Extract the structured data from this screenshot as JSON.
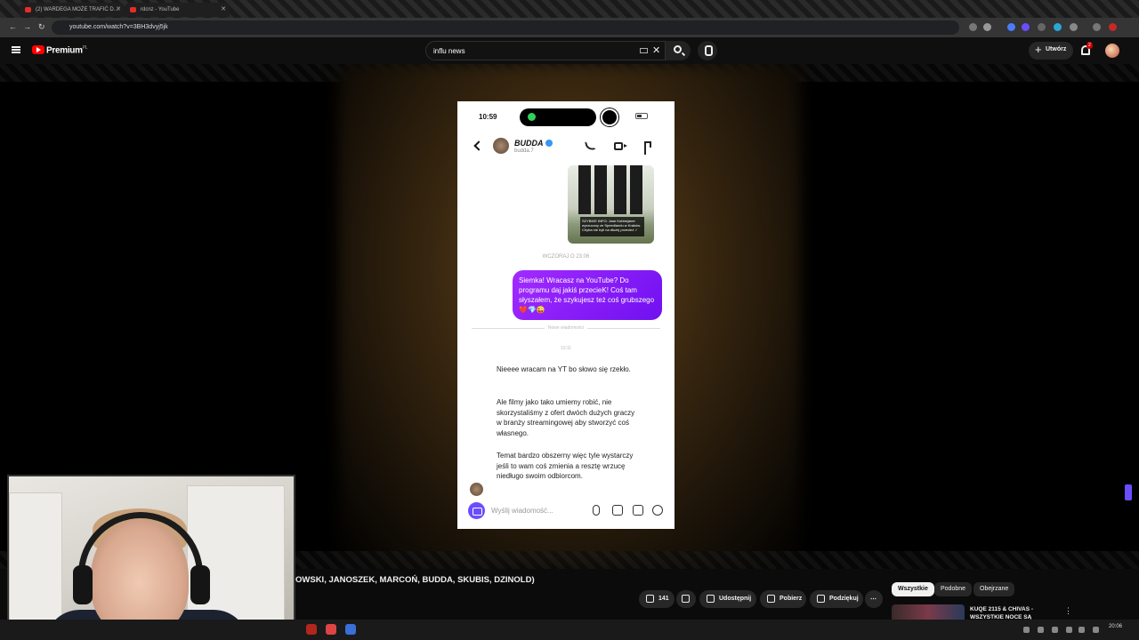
{
  "browser": {
    "tabs": [
      {
        "label": "(2) WARDEGA MOŻE TRAFIĆ D…",
        "active": false
      },
      {
        "label": "rdcnz - YouTube",
        "active": true
      }
    ],
    "url": "youtube.com/watch?v=3BH3dvyj5jk"
  },
  "youtube": {
    "brand": "Premium",
    "brand_region": "PL",
    "search_value": "influ news",
    "create_label": "Utwórz",
    "notification_count": "2",
    "accent_color": "#ff0000"
  },
  "phone": {
    "time": "10:59",
    "contact_name": "BUDDA",
    "contact_username": "budda.7",
    "image_caption": "SZYBKIE INFO: Jose Kobbejaner wyrzucony ze Speedlandu w Kraków. Chyba nie byli na dłużej przecież :/",
    "date_divider": "WCZORAJ O 23:06",
    "outgoing_message": "Siemka! Wracasz na YouTube? Do programu daj jakiś przecieK! Coś tam słyszałem, że szykujesz też coś grubszego ❤️💎😜",
    "new_messages_label": "Nowe wiadomości",
    "incoming_time": "10:11",
    "incoming_messages": [
      "Nieeee wracam na YT bo słowo się rzekło.",
      "Ale filmy jako tako umiemy robić, nie skorzystaliśmy z ofert dwóch dużych graczy w branży streamingowej aby stworzyć coś własnego.",
      "Temat bardzo obszerny więc tyle wystarczy jeśli to wam coś zmienia a resztę wrzucę niedługo swoim odbiorcom."
    ],
    "composer_placeholder": "Wyślij wiadomość...",
    "bubble_color": "#8a1cf5"
  },
  "video": {
    "title_visible": "OWSKI, JANOSZEK, MARCOŃ, BUDDA, SKUBIS, DZINOLD)",
    "like_count": "141",
    "share_label": "Udostępnij",
    "download_label": "Pobierz",
    "thanks_label": "Podziękuj"
  },
  "sidebar": {
    "chips": [
      "Wszystkie",
      "Podobne",
      "Obejrzane"
    ],
    "rec_title": "KUQE 2115 & CHIVAS - WSZYSTKIE NOCE SĄ"
  },
  "taskbar": {
    "clock": "20:06"
  }
}
